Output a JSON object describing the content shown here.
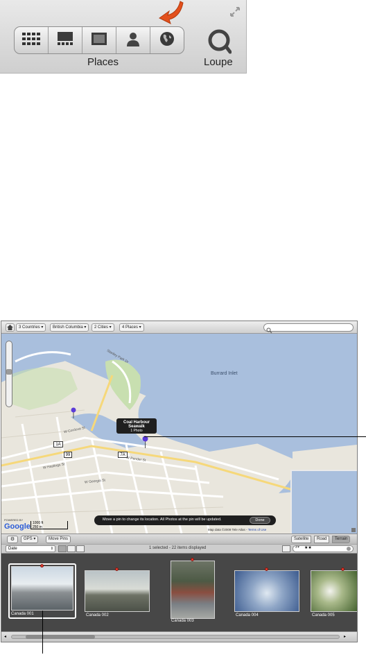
{
  "toolbar": {
    "views": [
      {
        "icon": "grid-view-icon"
      },
      {
        "icon": "filmstrip-view-icon"
      },
      {
        "icon": "viewer-view-icon"
      },
      {
        "icon": "faces-icon"
      },
      {
        "icon": "places-globe-icon"
      }
    ],
    "places_label": "Places",
    "loupe_label": "Loupe",
    "arrow_color": "#e3501c"
  },
  "breadcrumbs": [
    "3 Countries",
    "British Columbia",
    "2 Cities",
    "4 Places"
  ],
  "map": {
    "water_label": "Burrard Inlet",
    "streets": [
      "W Cordova St",
      "W Pender St",
      "W Hastings St",
      "W Georgia St",
      "Stanley Park Dr"
    ],
    "route_markers": [
      "1A",
      "99",
      "7A"
    ],
    "pin_tooltip_title": "Coal Harbour Seawalk",
    "pin_tooltip_sub": "1 Photo",
    "attribution_prefix": "Map data ©2009 Tele Atlas - ",
    "terms_link": "Terms of Use",
    "scale_ft": "1000 ft",
    "scale_m": "250 m",
    "google_powered": "POWERED BY",
    "google_logo": "Google",
    "hint_text": "Move a pin to change its location. All Photos at the pin will be updated.",
    "done_label": "Done",
    "colors": {
      "water": "#a9bfdd",
      "land": "#e9e6dd",
      "park": "#c8dfb0",
      "road": "#ffffff",
      "pin": "#5b3bd8"
    }
  },
  "mapbar": {
    "gps_label": "GPS",
    "move_pins_label": "Move Pins",
    "map_types": [
      "Satellite",
      "Road",
      "Terrain"
    ],
    "active_map_type": "Terrain"
  },
  "listbar": {
    "sort_value": "Date",
    "status": "1 selected - 22 items displayed"
  },
  "photos": [
    {
      "caption": "Canada 001",
      "selected": true
    },
    {
      "caption": "Canada 002",
      "selected": false
    },
    {
      "caption": "Canada 003",
      "selected": false
    },
    {
      "caption": "Canada 004",
      "selected": false
    },
    {
      "caption": "Canada 005",
      "selected": false
    }
  ]
}
